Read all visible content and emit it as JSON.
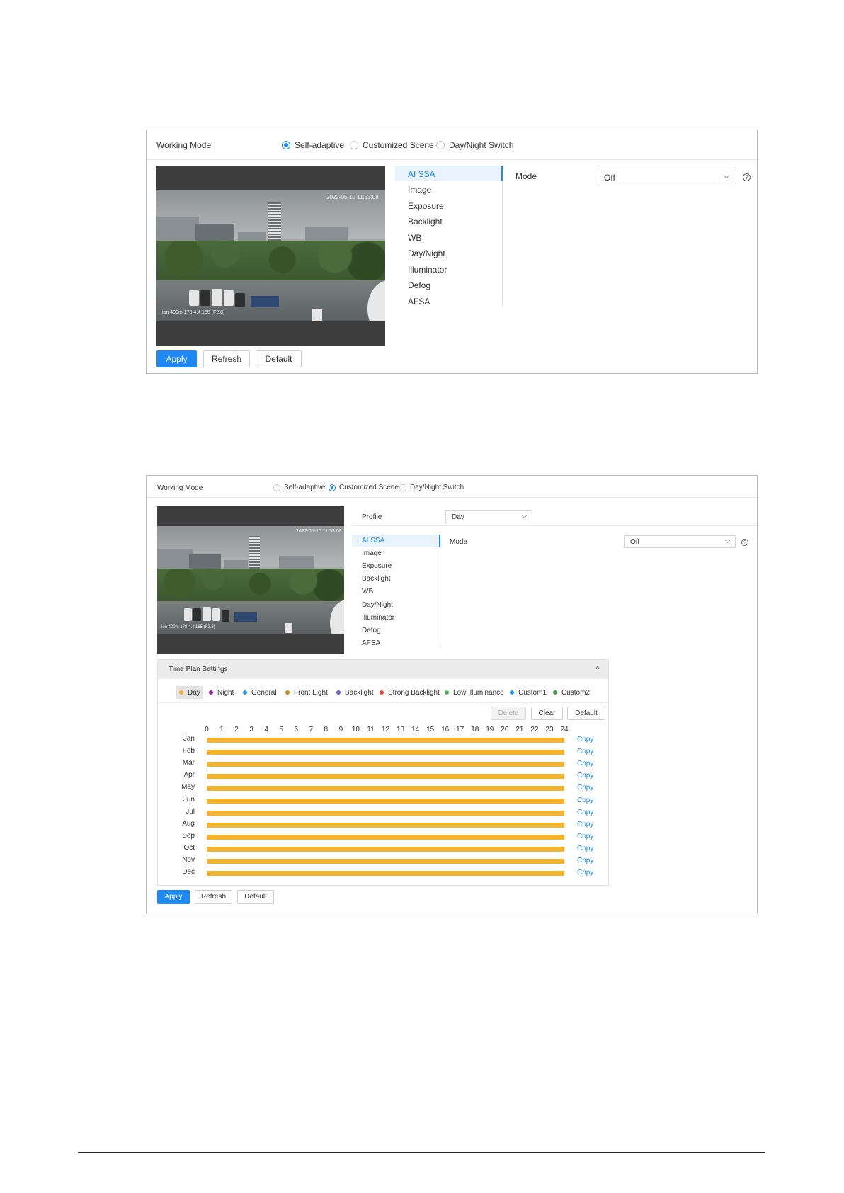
{
  "panel1": {
    "working_mode_label": "Working Mode",
    "modes": [
      {
        "label": "Self-adaptive",
        "selected": true
      },
      {
        "label": "Customized Scene",
        "selected": false
      },
      {
        "label": "Day/Night Switch",
        "selected": false
      }
    ],
    "video_osd": {
      "timestamp": "2022-05-10 11:53:08",
      "caption": "ion 400m 178.4.4.165 (F2.8)"
    },
    "menu": [
      "AI SSA",
      "Image",
      "Exposure",
      "Backlight",
      "WB",
      "Day/Night",
      "Illuminator",
      "Defog",
      "AFSA"
    ],
    "active_menu": "AI SSA",
    "mode_label": "Mode",
    "mode_value": "Off",
    "help_glyph": "?",
    "buttons": {
      "apply": "Apply",
      "refresh": "Refresh",
      "default": "Default"
    }
  },
  "panel2": {
    "working_mode_label": "Working Mode",
    "modes": [
      {
        "label": "Self-adaptive",
        "selected": false
      },
      {
        "label": "Customized Scene",
        "selected": true
      },
      {
        "label": "Day/Night Switch",
        "selected": false
      }
    ],
    "profile_label": "Profile",
    "profile_value": "Day",
    "video_osd": {
      "timestamp": "2022-05-10 11:53:08",
      "caption": "ion 400m 178.4.4.165 (F2.8)"
    },
    "menu": [
      "AI SSA",
      "Image",
      "Exposure",
      "Backlight",
      "WB",
      "Day/Night",
      "Illuminator",
      "Defog",
      "AFSA"
    ],
    "active_menu": "AI SSA",
    "mode_label": "Mode",
    "mode_value": "Off",
    "help_glyph": "?",
    "time_plan": {
      "title": "Time Plan Settings",
      "collapse_glyph": "˄",
      "legend": [
        {
          "label": "Day",
          "color": "#f4b32c",
          "selected": true
        },
        {
          "label": "Night",
          "color": "#9c27b0",
          "selected": false
        },
        {
          "label": "General",
          "color": "#2196f3",
          "selected": false
        },
        {
          "label": "Front Light",
          "color": "#c78a1e",
          "selected": false
        },
        {
          "label": "Backlight",
          "color": "#6a5acd",
          "selected": false
        },
        {
          "label": "Strong Backlight",
          "color": "#f44336",
          "selected": false
        },
        {
          "label": "Low Illuminance",
          "color": "#4caf50",
          "selected": false
        },
        {
          "label": "Custom1",
          "color": "#2196f3",
          "selected": false
        },
        {
          "label": "Custom2",
          "color": "#43a047",
          "selected": false
        }
      ],
      "buttons": {
        "delete": "Delete",
        "clear": "Clear",
        "default": "Default"
      },
      "hours": [
        "0",
        "1",
        "2",
        "3",
        "4",
        "5",
        "6",
        "7",
        "8",
        "9",
        "10",
        "11",
        "12",
        "13",
        "14",
        "15",
        "16",
        "17",
        "18",
        "19",
        "20",
        "21",
        "22",
        "23",
        "24"
      ],
      "months": [
        "Jan",
        "Feb",
        "Mar",
        "Apr",
        "May",
        "Jun",
        "Jul",
        "Aug",
        "Sep",
        "Oct",
        "Nov",
        "Dec"
      ],
      "bar_color": "#f4b32c",
      "copy_label": "Copy"
    },
    "buttons": {
      "apply": "Apply",
      "refresh": "Refresh",
      "default": "Default"
    }
  }
}
